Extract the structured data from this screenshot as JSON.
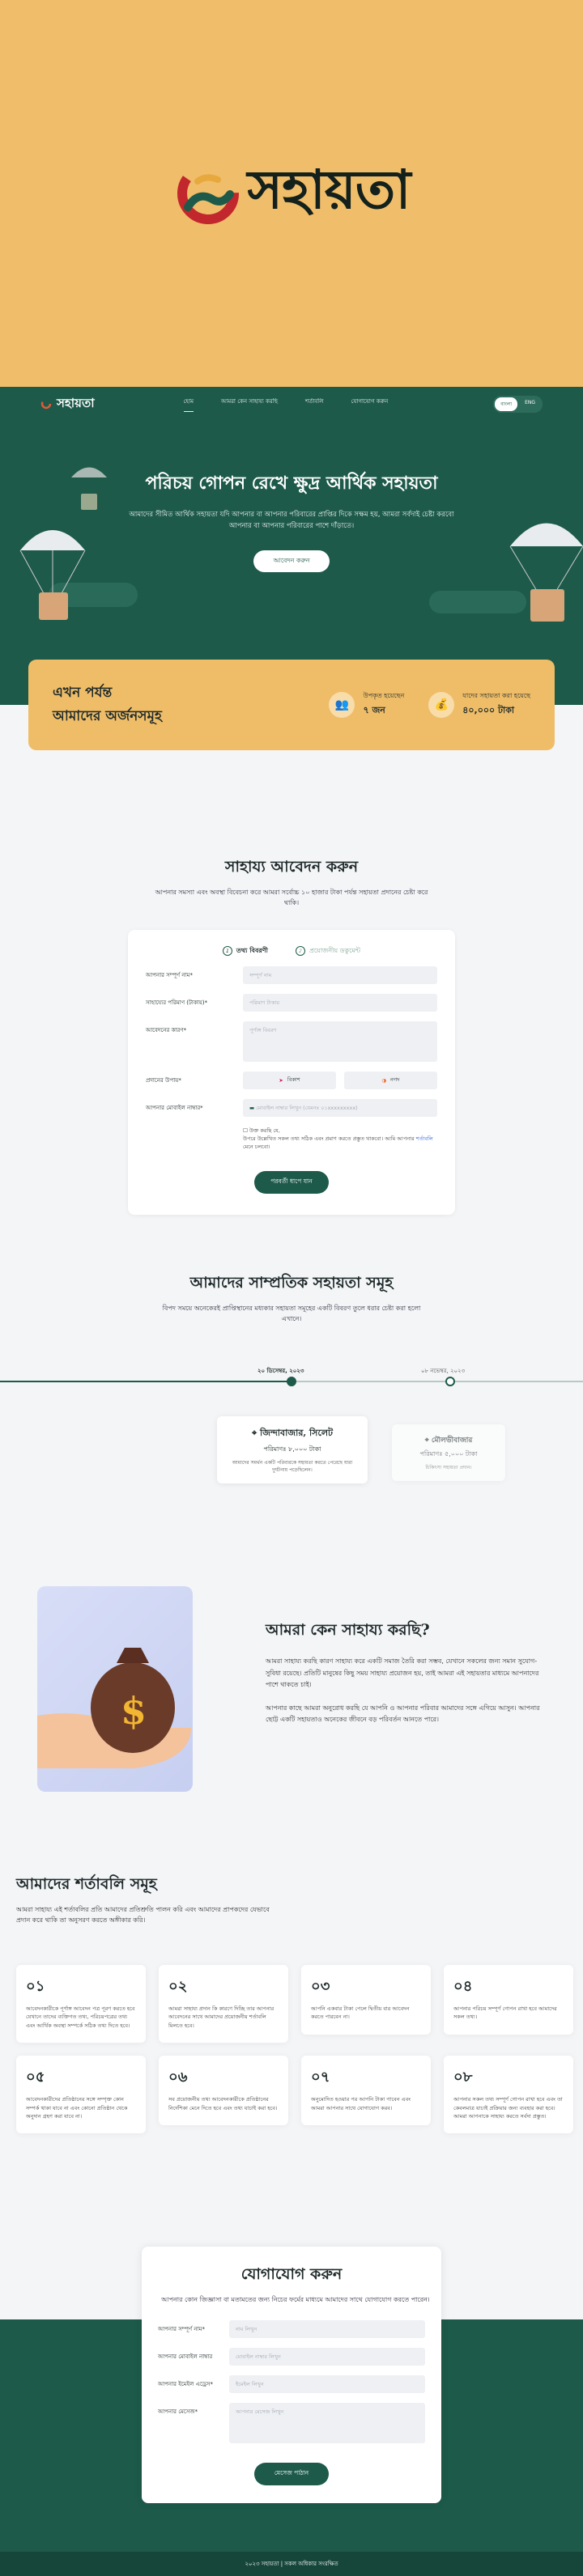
{
  "brand": {
    "name": "সহায়তা"
  },
  "nav": {
    "items": [
      "হোম",
      "আমরা কেন সাহায্য করছি",
      "শর্তাবলি",
      "যোগাযোগ করুন"
    ],
    "lang_bn": "বাংলা",
    "lang_en": "ENG"
  },
  "hero": {
    "title": "পরিচয় গোপন রেখে ক্ষুদ্র আর্থিক সহায়তা",
    "text": "আমাদের সীমিত আর্থিক সহায়তা যদি আপনার বা আপনার পরিবারের প্রাপ্তির দিকে সক্ষম হয়, আমরা সর্বদাই চেষ্টা করবো আপনার বা আপনার পরিবারের পাশে দাঁড়াতে।",
    "cta": "আবেদন করুন"
  },
  "stats": {
    "heading_line1": "এখন পর্যন্ত",
    "heading_line2": "আমাদের অর্জনসমূহ",
    "beneficiaries_label": "উপকৃত হয়েছেন",
    "beneficiaries_value": "৭ জন",
    "amount_label": "যাদের সহায়তা করা হয়েছে",
    "amount_value": "৪০,০০০ টাকা"
  },
  "apply": {
    "title": "সাহায্য আবেদন করুন",
    "subtitle": "আপনার সমস্যা এবং অবস্থা বিবেচনা করে আমরা সর্বোচ্চ ১০ হাজার টাকা পর্যন্ত সহায়তা প্রদানের চেষ্টা করে থাকি।",
    "step1": "তথ্য বিবরণী",
    "step2": "প্রয়োজনীয় ডকুমেন্ট",
    "fields": {
      "name_label": "আপনার সম্পূর্ণ নাম*",
      "name_ph": "সম্পূর্ণ নাম",
      "amount_label": "সাহায্যের পরিমাণ (টাকায়)*",
      "amount_ph": "পরিমাণ টাকায়",
      "reason_label": "আবেদনের কারণ*",
      "reason_ph": "পূর্ণাঙ্গ বিবরণ",
      "method_label": "প্রদানের উপায়*",
      "bkash": "বিকাশ",
      "nagad": "নগদ",
      "phone_label": "আপনার মোবাইল নাম্বার*",
      "phone_ph": "মোবাইল নাম্বার লিখুন (যেমনঃ ০১xxxxxxxxx)"
    },
    "check_text": "উপরে উল্লেখিত সকল তথ্য সঠিক এবং প্রমাণ করতে প্রস্তুত থাকবো। আমি আপনার",
    "check_link": "শর্তাবলি",
    "check_tail": "মেনে চলবো।",
    "check_head": "উক্ত করছি যে,",
    "next": "পরবর্তী ধাপে যান"
  },
  "recent": {
    "title": "আমাদের সাম্প্রতিক সহায়তা সমূহ",
    "subtitle": "বিপদ সময়ে অনেকেরই প্রাপ্তিস্থানের মধ্যকার সহায়তা সমূহের একটি বিবরণ তুলে ধরার চেষ্টা করা হলো এখানে।",
    "date1": "২০ ডিসেম্বর, ২০২৩",
    "date2": "০৮ নভেম্বর, ২০২৩",
    "card1_title": "জিন্দাবাজার, সিলেট",
    "card1_amount": "পরিমাণঃ ৮,০০০ টাকা",
    "card1_text": "আমাদের সমর্থন একটি পরিবারকে সহায়তা করতে পেরেছে যারা দুর্ঘটনায় পড়েছিলেন।",
    "card2_title": "মৌলভীবাজার",
    "card2_amount": "পরিমাণঃ ৫,০০০ টাকা",
    "card2_text": "চিকিৎসা সহায়তা প্রদান।"
  },
  "why": {
    "title": "আমরা কেন সাহায্য করছি?",
    "p1": "আমরা সাহায্য করছি কারণ সাহায্য করে একটি সমাজ তৈরি করা সম্ভব, যেখানে সকলের জন্য সমান সুযোগ-সুবিধা রয়েছে। প্রতিটি মানুষের কিছু সময় সাহায্য প্রয়োজন হয়, তাই আমরা এই সহায়তার মাধ্যমে আপনাদের পাশে থাকতে চাই।",
    "p2": "আপনার কাছে আমরা অনুরোধ করছি যে আপনি ও আপনার পরিবার আমাদের সঙ্গে এগিয়ে আসুন। আপনার ছোট্ট একটি সহায়তাও অনেকের জীবনে বড় পরিবর্তন আনতে পারে।"
  },
  "terms": {
    "title": "আমাদের শর্তাবলি সমূহ",
    "subtitle": "আমরা সাহায্য এই শর্তাবলির প্রতি আমাদের প্রতিশ্রুতি পালন করি এবং আমাদের প্রাপকদের যেভাবে প্রদান করে থাকি তা অনুসরণ করতে অঙ্গীকার করি।",
    "items": [
      {
        "n": "০১",
        "t": "আবেদনকারীকে পূর্ণাঙ্গ আবেদন পত্র পূরণ করতে হবে যেখানে তাদের ব্যক্তিগত তথ্য, পরিচয়পত্রের তথ্য এবং আর্থিক অবস্থা সম্পর্কে সঠিক তথ্য দিতে হবে।"
      },
      {
        "n": "০২",
        "t": "আমরা সাহায্য প্রদান কি কারণে দিচ্ছি তার আপনার আবেদনের সাথে আমাদের প্রয়োজনীয় শর্তাবলি মিলতে হবে।"
      },
      {
        "n": "০৩",
        "t": "আপনি একবার টাকা পেলে দ্বিতীয় বার আবেদন করতে পারবেন না।"
      },
      {
        "n": "০৪",
        "t": "আপনার পরিচয় সম্পূর্ণ গোপন রাখা হবে আমাদের সকল তথ্য।"
      },
      {
        "n": "০৫",
        "t": "আবেদনকারীদের প্রতিষ্ঠানের সঙ্গে সম্পৃক্ত কোন সম্পর্ক থাকা যাবে না এবং কোনো প্রতিষ্ঠান থেকে অনুদান গ্রহণ করা যাবে না।"
      },
      {
        "n": "০৬",
        "t": "সব প্রয়োজনীয় তথ্য আবেদনকারীকে প্রতিষ্ঠানের নির্দেশিকা মেনে দিতে হবে এবং তথ্য যাচাই করা হবে।"
      },
      {
        "n": "০৭",
        "t": "অনুমোদিত হওয়ার পর আপনি টাকা পাবেন এবং আমরা আপনার সাথে যোগাযোগ করব।"
      },
      {
        "n": "০৮",
        "t": "আপনার সকল তথ্য সম্পূর্ণ গোপন রাখা হবে এবং তা কেবলমাত্র যাচাই প্রক্রিয়ার জন্য ব্যবহার করা হবে। আমরা আপনাকে সাহায্য করতে সর্বদা প্রস্তুত।"
      }
    ]
  },
  "contact": {
    "title": "যোগাযোগ করুন",
    "subtitle": "আপনার কোন জিজ্ঞাসা বা মতামতের জন্য নিচের ফর্মের মাধ্যমে আমাদের সাথে যোগাযোগ করতে পারেন।",
    "name_label": "আপনার সম্পূর্ণ নাম*",
    "name_ph": "নাম লিখুন",
    "phone_label": "আপনার মোবাইল নাম্বার",
    "phone_ph": "মোবাইল নাম্বার লিখুন",
    "email_label": "আপনার ইমেইল এড্রেস*",
    "email_ph": "ইমেইল লিখুন",
    "msg_label": "আপনার মেসেজ*",
    "msg_ph": "আপনার মেসেজ লিখুন",
    "submit": "মেসেজ পাঠান"
  },
  "footer": "২০২৩ সহায়তা | সকল অধিকার সংরক্ষিত"
}
